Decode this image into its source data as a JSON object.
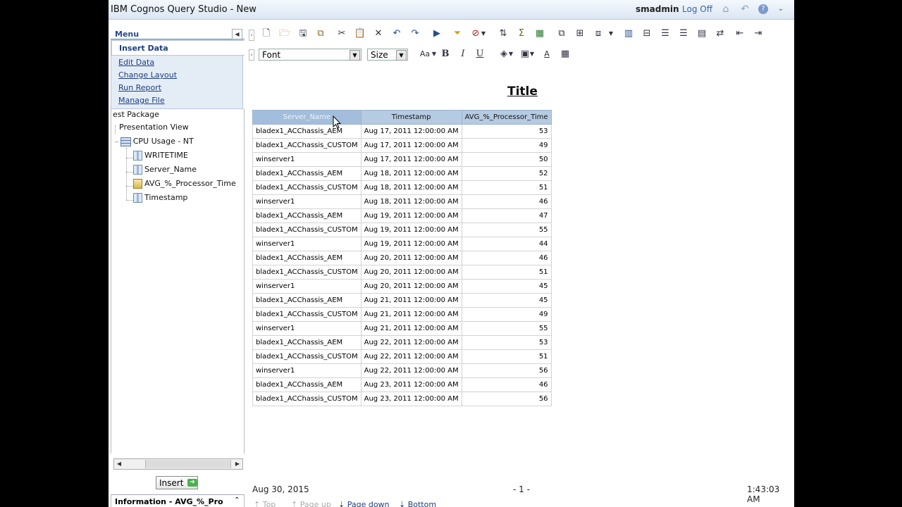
{
  "window": {
    "title": "IBM Cognos Query Studio - New",
    "user": "smadmin",
    "logoff": "Log Off"
  },
  "menu": {
    "title": "Menu",
    "items": [
      "Insert Data",
      "Edit Data",
      "Change Layout",
      "Run Report",
      "Manage File"
    ]
  },
  "tree": {
    "package": "est Package",
    "view": "Presentation View",
    "subject": "CPU Usage - NT",
    "items": [
      "WRITETIME",
      "Server_Name",
      "AVG_%_Processor_Time",
      "Timestamp"
    ]
  },
  "insert_label": "Insert",
  "info_label": "Information - AVG_%_Pro",
  "toolbar": {
    "font_placeholder": "Font",
    "size_placeholder": "Size"
  },
  "report": {
    "title": "Title",
    "columns": [
      "Server_Name",
      "Timestamp",
      "AVG_%_Processor_Time"
    ],
    "rows": [
      [
        "bladex1_ACChassis_AEM",
        "Aug 17, 2011 12:00:00 AM",
        "53"
      ],
      [
        "bladex1_ACChassis_CUSTOM",
        "Aug 17, 2011 12:00:00 AM",
        "49"
      ],
      [
        "winserver1",
        "Aug 17, 2011 12:00:00 AM",
        "50"
      ],
      [
        "bladex1_ACChassis_AEM",
        "Aug 18, 2011 12:00:00 AM",
        "52"
      ],
      [
        "bladex1_ACChassis_CUSTOM",
        "Aug 18, 2011 12:00:00 AM",
        "51"
      ],
      [
        "winserver1",
        "Aug 18, 2011 12:00:00 AM",
        "46"
      ],
      [
        "bladex1_ACChassis_AEM",
        "Aug 19, 2011 12:00:00 AM",
        "47"
      ],
      [
        "bladex1_ACChassis_CUSTOM",
        "Aug 19, 2011 12:00:00 AM",
        "55"
      ],
      [
        "winserver1",
        "Aug 19, 2011 12:00:00 AM",
        "44"
      ],
      [
        "bladex1_ACChassis_AEM",
        "Aug 20, 2011 12:00:00 AM",
        "46"
      ],
      [
        "bladex1_ACChassis_CUSTOM",
        "Aug 20, 2011 12:00:00 AM",
        "51"
      ],
      [
        "winserver1",
        "Aug 20, 2011 12:00:00 AM",
        "45"
      ],
      [
        "bladex1_ACChassis_AEM",
        "Aug 21, 2011 12:00:00 AM",
        "45"
      ],
      [
        "bladex1_ACChassis_CUSTOM",
        "Aug 21, 2011 12:00:00 AM",
        "49"
      ],
      [
        "winserver1",
        "Aug 21, 2011 12:00:00 AM",
        "55"
      ],
      [
        "bladex1_ACChassis_AEM",
        "Aug 22, 2011 12:00:00 AM",
        "53"
      ],
      [
        "bladex1_ACChassis_CUSTOM",
        "Aug 22, 2011 12:00:00 AM",
        "51"
      ],
      [
        "winserver1",
        "Aug 22, 2011 12:00:00 AM",
        "56"
      ],
      [
        "bladex1_ACChassis_AEM",
        "Aug 23, 2011 12:00:00 AM",
        "46"
      ],
      [
        "bladex1_ACChassis_CUSTOM",
        "Aug 23, 2011 12:00:00 AM",
        "56"
      ]
    ]
  },
  "footer": {
    "date": "Aug 30, 2015",
    "page": "- 1 -",
    "time": "1:43:03 AM",
    "nav": [
      "Top",
      "Page up",
      "Page down",
      "Bottom"
    ]
  }
}
